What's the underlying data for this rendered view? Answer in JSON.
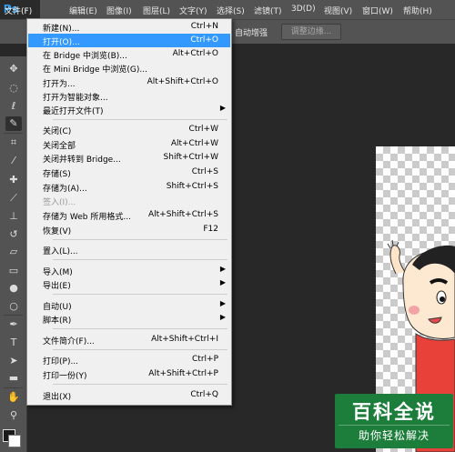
{
  "app": {
    "logo": "Ps"
  },
  "menubar": {
    "file": "文件(F)",
    "edit": "编辑(E)",
    "image": "图像(I)",
    "layer": "图层(L)",
    "type": "文字(Y)",
    "select": "选择(S)",
    "filter": "滤镜(T)",
    "three_d": "3D(D)",
    "view": "视图(V)",
    "window": "窗口(W)",
    "help": "帮助(H)"
  },
  "options_bar": {
    "auto_enhance": "自动增强",
    "refine_edge": "调整边缘..."
  },
  "file_menu": {
    "new": {
      "label": "新建(N)...",
      "shortcut": "Ctrl+N"
    },
    "open": {
      "label": "打开(O)...",
      "shortcut": "Ctrl+O"
    },
    "browse_bridge": {
      "label": "在 Bridge 中浏览(B)...",
      "shortcut": "Alt+Ctrl+O"
    },
    "browse_mini_bridge": {
      "label": "在 Mini Bridge 中浏览(G)...",
      "shortcut": ""
    },
    "open_as": {
      "label": "打开为...",
      "shortcut": "Alt+Shift+Ctrl+O"
    },
    "open_smart": {
      "label": "打开为智能对象...",
      "shortcut": ""
    },
    "open_recent": {
      "label": "最近打开文件(T)",
      "shortcut": ""
    },
    "close": {
      "label": "关闭(C)",
      "shortcut": "Ctrl+W"
    },
    "close_all": {
      "label": "关闭全部",
      "shortcut": "Alt+Ctrl+W"
    },
    "close_go_bridge": {
      "label": "关闭并转到 Bridge...",
      "shortcut": "Shift+Ctrl+W"
    },
    "save": {
      "label": "存储(S)",
      "shortcut": "Ctrl+S"
    },
    "save_as": {
      "label": "存储为(A)...",
      "shortcut": "Shift+Ctrl+S"
    },
    "check_in": {
      "label": "签入(I)...",
      "shortcut": ""
    },
    "save_web": {
      "label": "存储为 Web 所用格式...",
      "shortcut": "Alt+Shift+Ctrl+S"
    },
    "revert": {
      "label": "恢复(V)",
      "shortcut": "F12"
    },
    "place": {
      "label": "置入(L)...",
      "shortcut": ""
    },
    "import": {
      "label": "导入(M)",
      "shortcut": ""
    },
    "export": {
      "label": "导出(E)",
      "shortcut": ""
    },
    "automate": {
      "label": "自动(U)",
      "shortcut": ""
    },
    "scripts": {
      "label": "脚本(R)",
      "shortcut": ""
    },
    "file_info": {
      "label": "文件简介(F)...",
      "shortcut": "Alt+Shift+Ctrl+I"
    },
    "print": {
      "label": "打印(P)...",
      "shortcut": "Ctrl+P"
    },
    "print_one": {
      "label": "打印一份(Y)",
      "shortcut": "Alt+Shift+Ctrl+P"
    },
    "exit": {
      "label": "退出(X)",
      "shortcut": "Ctrl+Q"
    }
  },
  "watermark": {
    "title": "百科全说",
    "subtitle": "助你轻松解决"
  },
  "colors": {
    "accent": "#31a8ff",
    "menu_highlight": "#3399ff",
    "watermark_green": "#1d7e3c"
  }
}
